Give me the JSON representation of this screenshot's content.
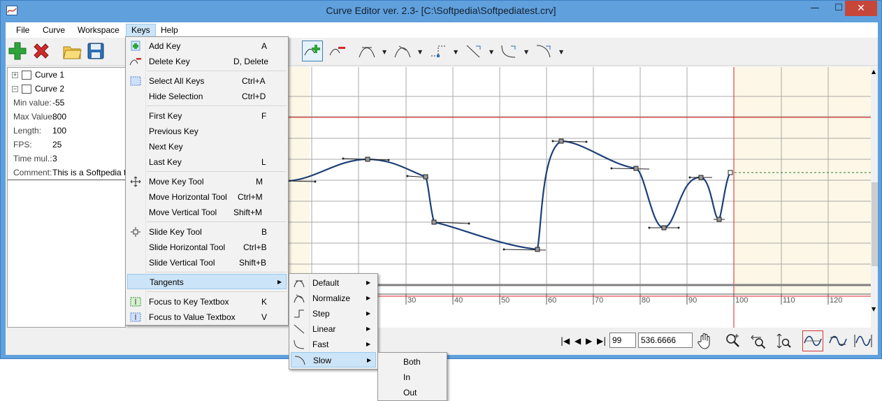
{
  "window": {
    "title": "Curve Editor ver. 2.3- [C:\\Softpedia\\Softpediatest.crv]",
    "minimize": "—",
    "maximize": "☐",
    "close": "✕"
  },
  "menubar": [
    "File",
    "Curve",
    "Workspace",
    "Keys",
    "Help"
  ],
  "tree": {
    "curves": [
      "Curve 1",
      "Curve 2"
    ],
    "properties": [
      {
        "label": "Min value:",
        "value": "-55"
      },
      {
        "label": "Max Value:",
        "value": "800"
      },
      {
        "label": "Length:",
        "value": "100"
      },
      {
        "label": "FPS:",
        "value": "25"
      },
      {
        "label": "Time mul.:",
        "value": "3"
      },
      {
        "label": "Comment:",
        "value": "This is a Softpedia test"
      }
    ]
  },
  "graph": {
    "x_ticks": [
      "30",
      "40",
      "50",
      "60",
      "70",
      "80",
      "90",
      "100",
      "110",
      "120"
    ]
  },
  "bottom": {
    "frame_value": "99",
    "key_value": "536.6666"
  },
  "keys_menu": {
    "items": [
      {
        "label": "Add Key",
        "shortcut": "A"
      },
      {
        "label": "Delete Key",
        "shortcut": "D, Delete"
      },
      {
        "label": "Select All Keys",
        "shortcut": "Ctrl+A"
      },
      {
        "label": "Hide Selection",
        "shortcut": "Ctrl+D"
      },
      {
        "label": "First Key",
        "shortcut": "F"
      },
      {
        "label": "Previous Key",
        "shortcut": ""
      },
      {
        "label": "Next Key",
        "shortcut": ""
      },
      {
        "label": "Last Key",
        "shortcut": "L"
      },
      {
        "label": "Move Key Tool",
        "shortcut": "M"
      },
      {
        "label": "Move Horizontal Tool",
        "shortcut": "Ctrl+M"
      },
      {
        "label": "Move Vertical Tool",
        "shortcut": "Shift+M"
      },
      {
        "label": "Slide Key Tool",
        "shortcut": "B"
      },
      {
        "label": "Slide Horizontal Tool",
        "shortcut": "Ctrl+B"
      },
      {
        "label": "Slide Vertical Tool",
        "shortcut": "Shift+B"
      },
      {
        "label": "Tangents",
        "shortcut": ""
      },
      {
        "label": "Focus to Key Textbox",
        "shortcut": "K"
      },
      {
        "label": "Focus to Value Textbox",
        "shortcut": "V"
      }
    ]
  },
  "tangents_menu": [
    "Default",
    "Normalize",
    "Step",
    "Linear",
    "Fast",
    "Slow"
  ],
  "slow_menu": [
    "Both",
    "In",
    "Out"
  ],
  "colors": {
    "title_bar": "#5fa0dd",
    "menu_highlight": "#cce4f7",
    "curve": "#1c3f77",
    "limit_line": "#e02020",
    "beyond_fill": "#fcf7e6"
  }
}
